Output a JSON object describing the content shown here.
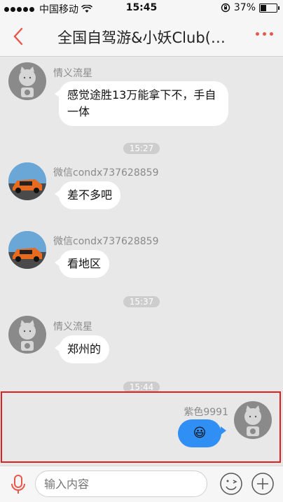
{
  "status": {
    "carrier": "中国移动",
    "time": "15:45",
    "battery": "37%"
  },
  "nav": {
    "title": "全国自驾游&小妖Club(…",
    "back_icon": "back-chevron-icon",
    "more_icon": "more-dots-icon"
  },
  "messages": [
    {
      "sender": "情义流星",
      "text": "感觉途胜13万能拿下不，手自一体",
      "avatar": "default"
    },
    {
      "timestamp": "15:27"
    },
    {
      "sender": "微信condx737628859",
      "text": "差不多吧",
      "avatar": "car"
    },
    {
      "sender": "微信condx737628859",
      "text": "看地区",
      "avatar": "car"
    },
    {
      "timestamp": "15:37"
    },
    {
      "sender": "情义流星",
      "text": "郑州的",
      "avatar": "default"
    },
    {
      "timestamp": "15:44"
    },
    {
      "sender": "紫色9991",
      "text": "😃",
      "avatar": "default",
      "self": true
    }
  ],
  "input": {
    "placeholder": "输入内容"
  },
  "colors": {
    "accent": "#e8574a",
    "self_bubble": "#2f8ff5",
    "highlight": "#e02020"
  }
}
